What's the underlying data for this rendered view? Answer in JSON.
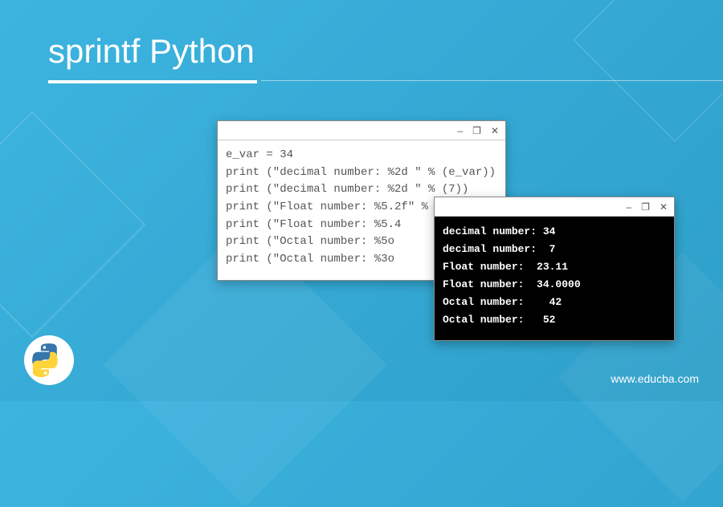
{
  "title": "sprintf Python",
  "window1": {
    "code": "e_var = 34\nprint (\"decimal number: %2d \" % (e_var))\nprint (\"decimal number: %2d \" % (7))\nprint (\"Float number: %5.2f\" % ( 23.11))\nprint (\"Float number: %5.4\nprint (\"Octal number: %5o\nprint (\"Octal number: %3o"
  },
  "window2": {
    "output": "decimal number: 34\ndecimal number:  7\nFloat number:  23.11\nFloat number:  34.0000\nOctal number:    42\nOctal number:   52"
  },
  "windowControls": {
    "minimize": "–",
    "maximize": "❐",
    "close": "✕"
  },
  "watermark": "www.educba.com"
}
